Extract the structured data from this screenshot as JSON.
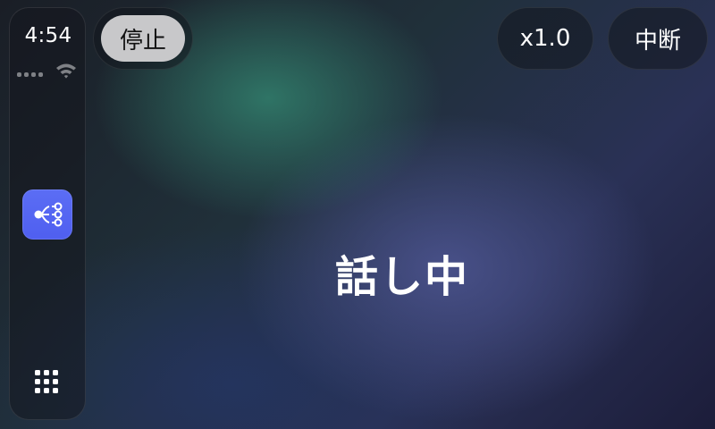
{
  "sidebar": {
    "time": "4:54",
    "signal_bars": 4,
    "icons": [
      "cellular-signal-icon",
      "wifi-icon",
      "share-tree-app-icon",
      "app-grid-icon"
    ]
  },
  "controls": {
    "stop_label": "停止",
    "speed_label": "x1.0",
    "interrupt_label": "中断"
  },
  "main": {
    "status_text": "話し中"
  },
  "colors": {
    "app_icon": "#5065f2",
    "stop_pill": "#c8c8ca",
    "text": "#ffffff"
  }
}
